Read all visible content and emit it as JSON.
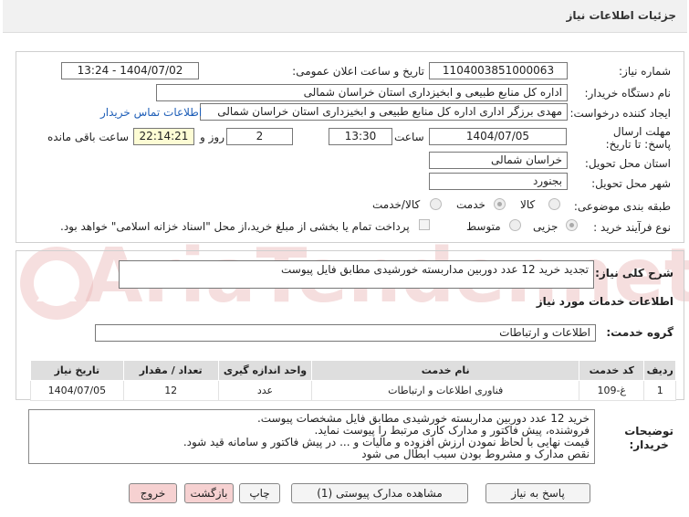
{
  "header": {
    "title": "جزئیات اطلاعات نیاز"
  },
  "watermark": {
    "text": "AriaTender.net"
  },
  "form": {
    "need_number_label": "شماره نیاز:",
    "need_number": "1104003851000063",
    "announce_label": "تاریخ و ساعت اعلان عمومی:",
    "announce_value": "1404/07/02 - 13:24",
    "buyer_org_label": "نام دستگاه خریدار:",
    "buyer_org": "اداره کل منابع طبیعی و ابخیزداری استان خراسان شمالی",
    "requester_label": "ایجاد کننده درخواست:",
    "requester": "مهدی برزگر اداری اداره کل منابع طبیعی و ابخیزداری استان خراسان شمالی",
    "contact_link": "اطلاعات تماس خریدار",
    "deadline_label": "مهلت ارسال پاسخ: تا تاریخ:",
    "deadline_date": "1404/07/05",
    "time_label": "ساعت",
    "deadline_time": "13:30",
    "days_value": "2",
    "days_label": "روز و",
    "remaining_time": "22:14:21",
    "remaining_label": "ساعت باقی مانده",
    "province_label": "استان محل تحویل:",
    "province": "خراسان شمالی",
    "city_label": "شهر محل تحویل:",
    "city": "بجنورد",
    "category_label": "طبقه بندی موضوعی:",
    "category_options": [
      "کالا",
      "خدمت",
      "کالا/خدمت"
    ],
    "process_label": "نوع فرآیند خرید :",
    "process_options": [
      "جزیی",
      "متوسط"
    ],
    "payment_note": "پرداخت تمام یا بخشی از مبلغ خرید،از محل \"اسناد خزانه اسلامی\" خواهد بود."
  },
  "need": {
    "summary_label": "شرح کلی نیاز:",
    "summary": "تجدید خرید 12 عدد دوربین مداربسته خورشیدی مطابق فایل پیوست",
    "services_heading": "اطلاعات خدمات مورد نیاز",
    "group_label": "گروه خدمت:",
    "group": "اطلاعات و ارتباطات"
  },
  "table": {
    "headers": [
      "ردیف",
      "کد خدمت",
      "نام خدمت",
      "واحد اندازه گیری",
      "تعداد / مقدار",
      "تاریخ نیاز"
    ],
    "rows": [
      [
        "1",
        "غ-109",
        "فناوری اطلاعات و ارتباطات",
        "عدد",
        "12",
        "1404/07/05"
      ]
    ]
  },
  "buyer_notes": {
    "label_line1": "توضیحات",
    "label_line2": "خریدار:",
    "lines": [
      "خرید 12 عدد دوربین مداربسته خورشیدی مطابق فایل مشخصات پیوست.",
      "فروشنده، پیش فاکتور و مدارک کاری مرتبط را پیوست نماید.",
      "قیمت نهایی با لحاظ نمودن ارزش افزوده و مالیات و ... در پیش فاکتور و سامانه قید شود.",
      "نقص مدارک و مشروط بودن سبب ابطال می شود"
    ]
  },
  "buttons": {
    "reply": "پاسخ به نیاز",
    "attachments": "مشاهده مدارک پیوستی (1)",
    "print": "چاپ",
    "back": "بازگشت",
    "exit": "خروج"
  }
}
